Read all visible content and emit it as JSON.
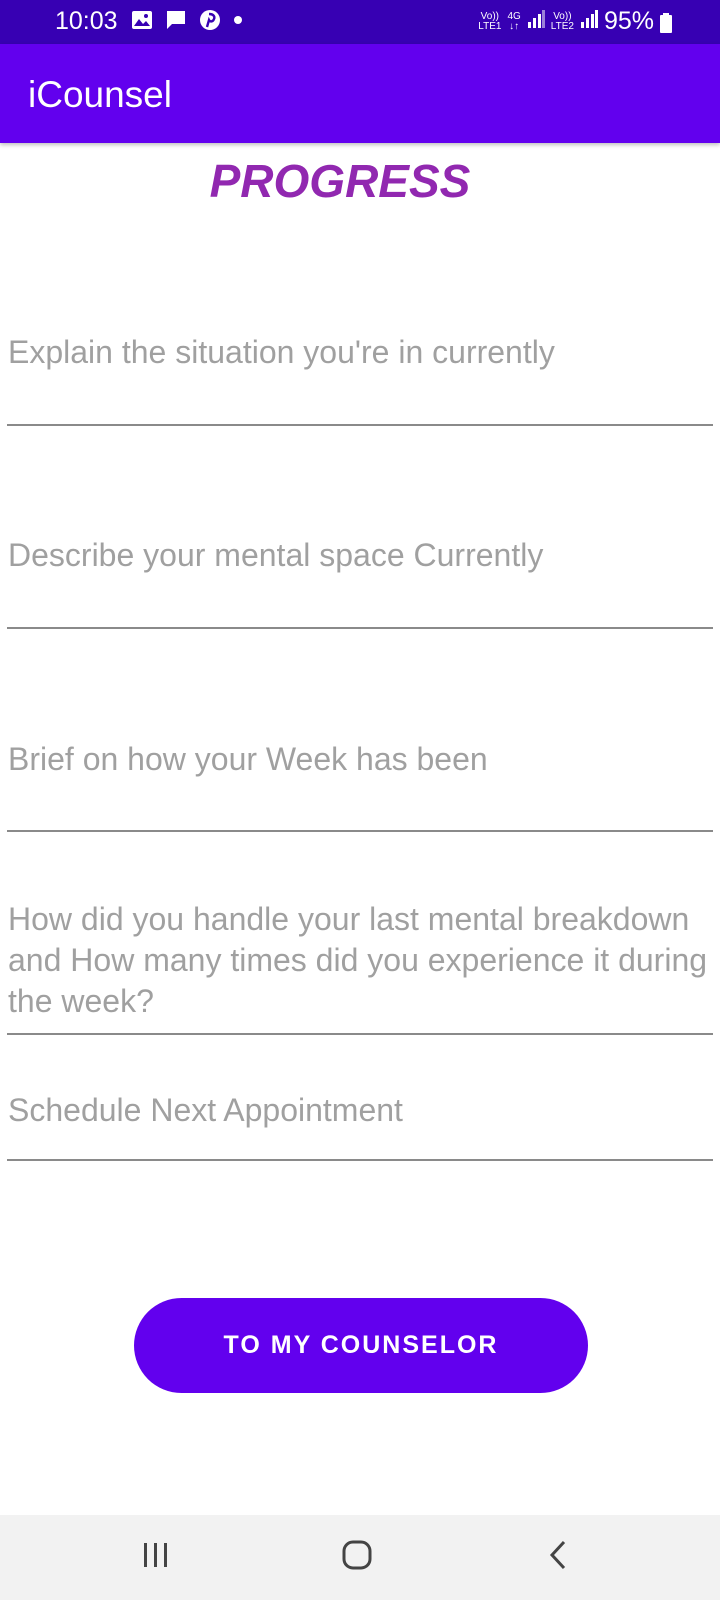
{
  "status_bar": {
    "time": "10:03",
    "icons": [
      "image-icon",
      "message-icon",
      "pinterest-icon",
      "dot-icon"
    ],
    "net1": [
      "Vo))",
      "LTE1"
    ],
    "net_4g": [
      "4G",
      "↓↑"
    ],
    "net2": [
      "Vo))",
      "LTE2"
    ],
    "battery": "95%",
    "color": "#3700b3"
  },
  "app_bar": {
    "title": "iCounsel",
    "color": "#6200ee"
  },
  "page": {
    "heading": "PROGRESS",
    "heading_color": "#9128b0"
  },
  "fields": {
    "situation": {
      "placeholder": "Explain the situation you're in currently"
    },
    "mental_space": {
      "placeholder": "Describe your mental space Currently"
    },
    "week": {
      "placeholder": "Brief on how your Week has been"
    },
    "breakdown": {
      "placeholder": "How did you handle your last mental breakdown and How many times did you experience it during the week?"
    },
    "appointment": {
      "placeholder": "Schedule Next Appointment"
    }
  },
  "actions": {
    "counselor_button": "TO MY COUNSELOR"
  },
  "nav_bar": {
    "icons": [
      "recents-icon",
      "home-icon",
      "back-icon"
    ]
  }
}
